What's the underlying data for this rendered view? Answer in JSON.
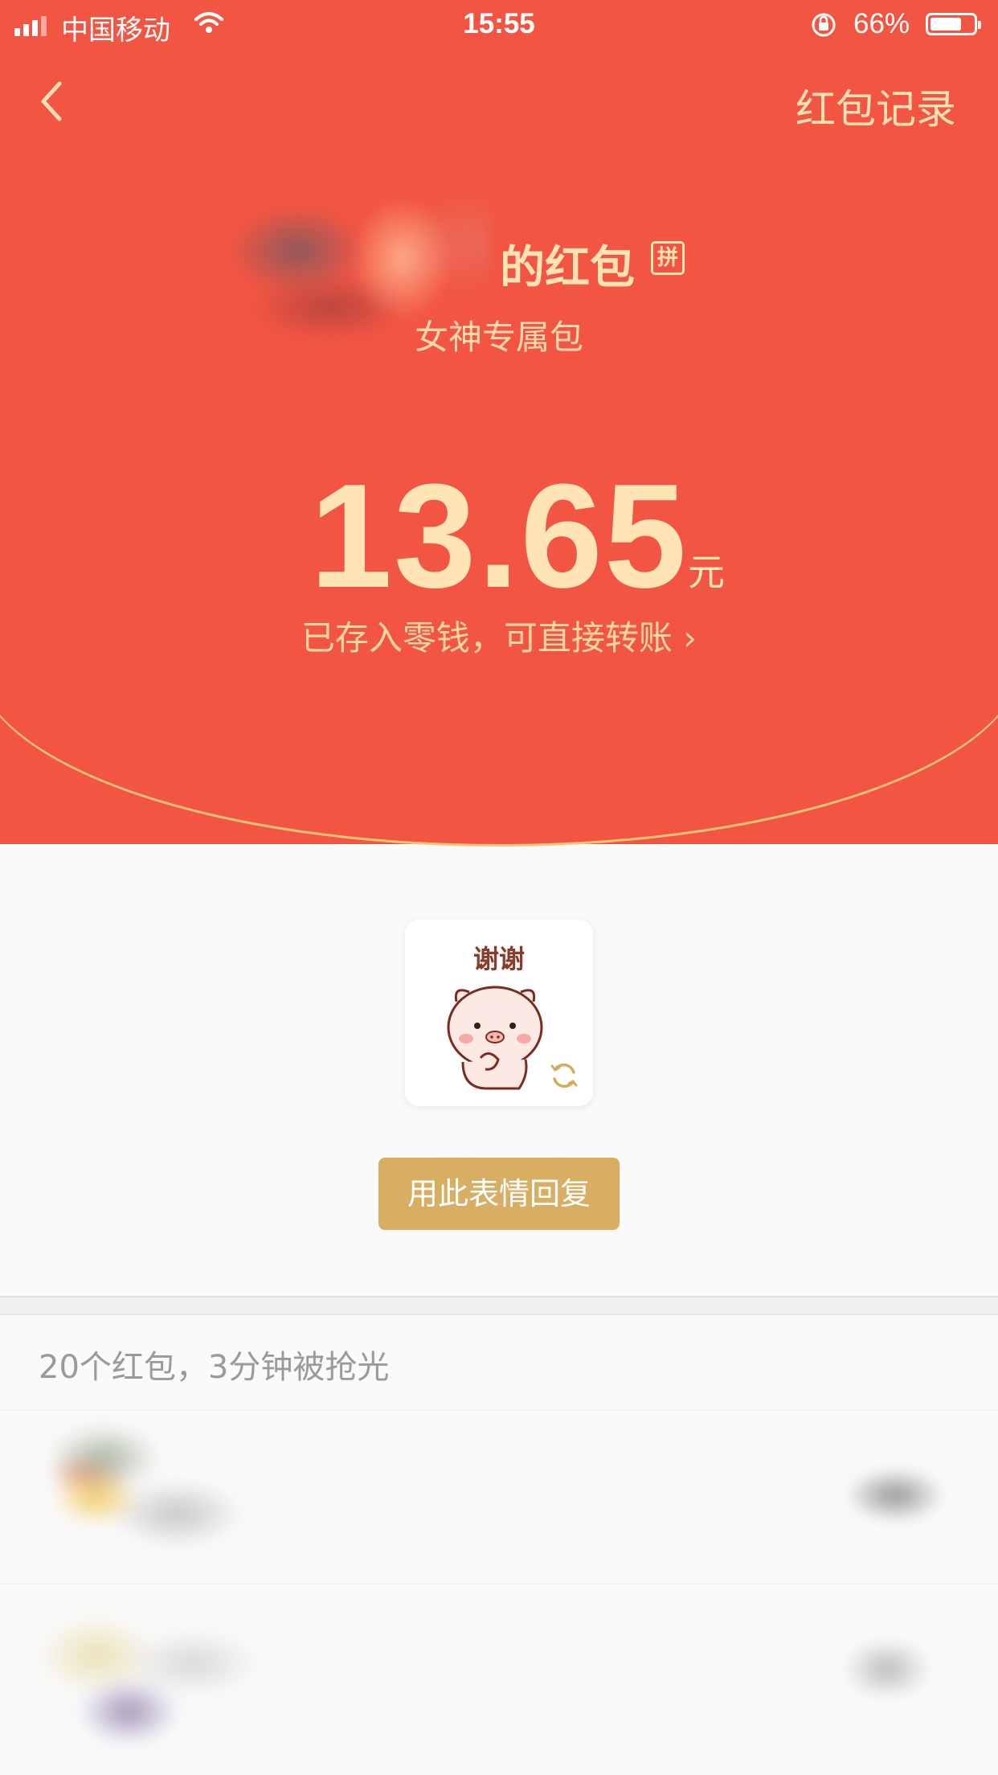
{
  "status_bar": {
    "carrier": "中国移动",
    "time": "15:55",
    "battery_percent": "66%"
  },
  "nav": {
    "records_label": "红包记录"
  },
  "red_packet": {
    "sender_suffix": "的红包",
    "type_badge": "拼",
    "blessing": "女神专属包",
    "amount": "13.65",
    "currency": "元",
    "deposit_text": "已存入零钱，可直接转账 ›"
  },
  "sticker": {
    "text": "谢谢",
    "reply_button": "用此表情回复"
  },
  "summary": {
    "text": "20个红包，3分钟被抢光"
  },
  "colors": {
    "header_red": "#f25643",
    "gold": "#d8ae63",
    "cream": "#ffe4b6"
  }
}
